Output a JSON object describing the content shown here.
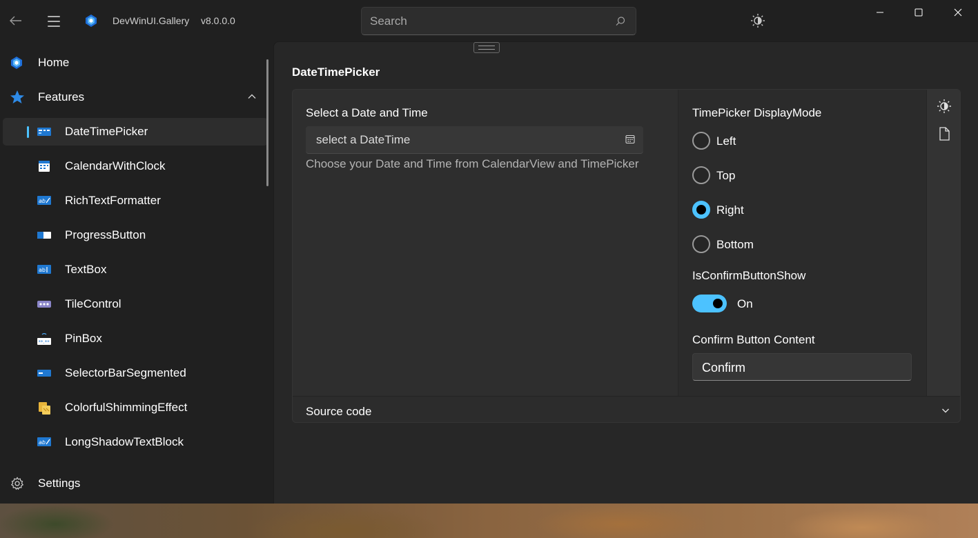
{
  "app": {
    "title": "DevWinUI.Gallery",
    "version": "v8.0.0.0"
  },
  "search": {
    "placeholder": "Search",
    "value": ""
  },
  "sidebar": {
    "home": "Home",
    "features": "Features",
    "items": [
      {
        "label": "DateTimePicker",
        "selected": true
      },
      {
        "label": "CalendarWithClock"
      },
      {
        "label": "RichTextFormatter"
      },
      {
        "label": "ProgressButton"
      },
      {
        "label": "TextBox"
      },
      {
        "label": "TileControl"
      },
      {
        "label": "PinBox"
      },
      {
        "label": "SelectorBarSegmented"
      },
      {
        "label": "ColorfulShimmingEffect"
      },
      {
        "label": "LongShadowTextBlock"
      }
    ],
    "settings": "Settings"
  },
  "page": {
    "title": "DateTimePicker"
  },
  "demo": {
    "header": "Select a Date and Time",
    "placeholder": "select a DateTime",
    "description": "Choose your Date and Time from CalendarView and TimePicker"
  },
  "options": {
    "display_mode_label": "TimePicker DisplayMode",
    "radios": [
      {
        "label": "Left",
        "checked": false
      },
      {
        "label": "Top",
        "checked": false
      },
      {
        "label": "Right",
        "checked": true
      },
      {
        "label": "Bottom",
        "checked": false
      }
    ],
    "confirm_show_label": "IsConfirmButtonShow",
    "toggle_state": "On",
    "confirm_content_label": "Confirm Button Content",
    "confirm_content_value": "Confirm"
  },
  "source": {
    "label": "Source code"
  },
  "colors": {
    "accent": "#4cc2ff",
    "background": "#202020",
    "card": "#2c2c2c"
  }
}
